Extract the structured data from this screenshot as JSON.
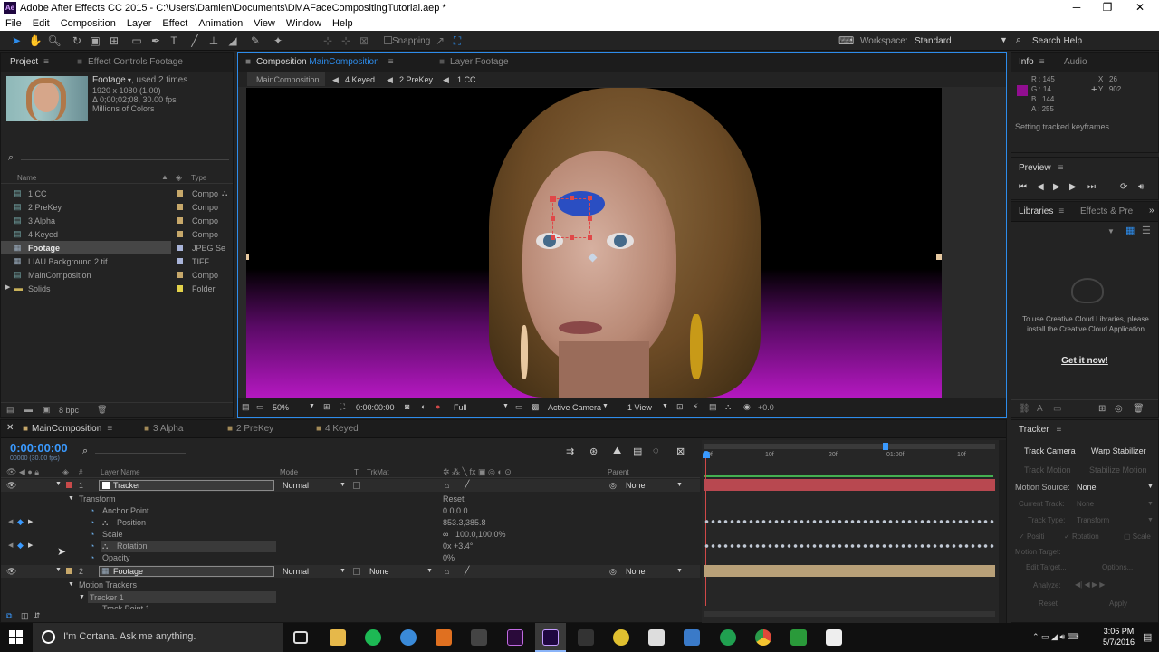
{
  "window": {
    "title": "Adobe After Effects CC 2015 - C:\\Users\\Damien\\Documents\\DMAFaceCompositingTutorial.aep *",
    "app_icon": "Ae"
  },
  "menu": [
    "File",
    "Edit",
    "Composition",
    "Layer",
    "Effect",
    "Animation",
    "View",
    "Window",
    "Help"
  ],
  "toolbar": {
    "snapping": "Snapping",
    "workspace_label": "Workspace:",
    "workspace_value": "Standard",
    "search_help": "Search Help"
  },
  "project": {
    "tab_project": "Project",
    "tab_effect_controls": "Effect Controls Footage",
    "footage_name": "Footage",
    "footage_used": ", used 2 times",
    "footage_info": [
      "1920 x 1080 (1.00)",
      "Δ 0;00;02;08, 30.00 fps",
      "Millions of Colors"
    ],
    "col_name": "Name",
    "col_type": "Type",
    "items": [
      {
        "name": "1 CC",
        "type": "Compo",
        "color": "#c7a86a"
      },
      {
        "name": "2 PreKey",
        "type": "Compo",
        "color": "#c7a86a"
      },
      {
        "name": "3 Alpha",
        "type": "Compo",
        "color": "#c7a86a"
      },
      {
        "name": "4 Keyed",
        "type": "Compo",
        "color": "#c7a86a"
      },
      {
        "name": "Footage",
        "type": "JPEG Se",
        "color": "#a9b4d8"
      },
      {
        "name": "LIAU Background 2.tif",
        "type": "TIFF",
        "color": "#a9b4d8"
      },
      {
        "name": "MainComposition",
        "type": "Compo",
        "color": "#c7a86a"
      },
      {
        "name": "Solids",
        "type": "Folder",
        "color": "#e3d24a"
      }
    ],
    "bpc": "8 bpc"
  },
  "composition": {
    "tab_label": "Composition",
    "tab_comp": "MainComposition",
    "tab_layer": "Layer Footage",
    "flow": [
      "MainComposition",
      "4 Keyed",
      "2 PreKey",
      "1 CC"
    ],
    "zoom": "50%",
    "time": "0:00:00:00",
    "resolution": "Full",
    "camera": "Active Camera",
    "views": "1 View",
    "exposure": "+0.0"
  },
  "info": {
    "tab_info": "Info",
    "tab_audio": "Audio",
    "r": "R : 145",
    "g": "G : 14",
    "b": "B : 144",
    "a": "A : 255",
    "x": "X : 26",
    "y": "Y : 902",
    "color": "#910e90",
    "status": "Setting tracked keyframes"
  },
  "preview": {
    "label": "Preview"
  },
  "libraries": {
    "tab_libraries": "Libraries",
    "tab_effects": "Effects & Pre",
    "message": "To use Creative Cloud Libraries, please install the Creative Cloud Application",
    "link": "Get it now!"
  },
  "timeline": {
    "tabs": [
      "MainComposition",
      "3 Alpha",
      "2 PreKey",
      "4 Keyed"
    ],
    "timecode": "0:00:00:00",
    "fps": "00000 (30.00 fps)",
    "col_layer_name": "Layer Name",
    "col_mode": "Mode",
    "col_t": "T",
    "col_trkmat": "TrkMat",
    "col_parent": "Parent",
    "ruler": [
      "0f",
      "10f",
      "20f",
      "01:00f",
      "10f"
    ],
    "layers": [
      {
        "num": "1",
        "name": "Tracker",
        "mode": "Normal",
        "trkmat": "",
        "parent": "None",
        "color": "#c84a4a"
      },
      {
        "num": "2",
        "name": "Footage",
        "mode": "Normal",
        "trkmat": "None",
        "parent": "None",
        "color": "#c7a86a"
      }
    ],
    "transform": "Transform",
    "reset": "Reset",
    "props": [
      {
        "name": "Anchor Point",
        "value": "0.0,0.0"
      },
      {
        "name": "Position",
        "value": "853.3,385.8"
      },
      {
        "name": "Scale",
        "value": "100.0,100.0%"
      },
      {
        "name": "Rotation",
        "value": "0x +3.4°"
      },
      {
        "name": "Opacity",
        "value": "0%"
      }
    ],
    "motion_trackers": "Motion Trackers",
    "tracker1": "Tracker 1",
    "track_point": "Track Point 1"
  },
  "tracker": {
    "title": "Tracker",
    "track_camera": "Track Camera",
    "warp_stabilizer": "Warp Stabilizer",
    "track_motion": "Track Motion",
    "stabilize_motion": "Stabilize Motion",
    "motion_source_label": "Motion Source:",
    "motion_source_value": "None",
    "current_track_label": "Current Track:",
    "current_track_value": "None",
    "track_type_label": "Track Type:",
    "track_type_value": "Transform",
    "position": "Positi",
    "rotation": "Rotation",
    "scale": "Scale",
    "motion_target": "Motion Target:",
    "edit_target": "Edit Target...",
    "options": "Options...",
    "analyze": "Analyze:",
    "reset": "Reset",
    "apply": "Apply"
  },
  "taskbar": {
    "cortana": "I'm Cortana. Ask me anything.",
    "time": "3:06 PM",
    "date": "5/7/2016"
  }
}
